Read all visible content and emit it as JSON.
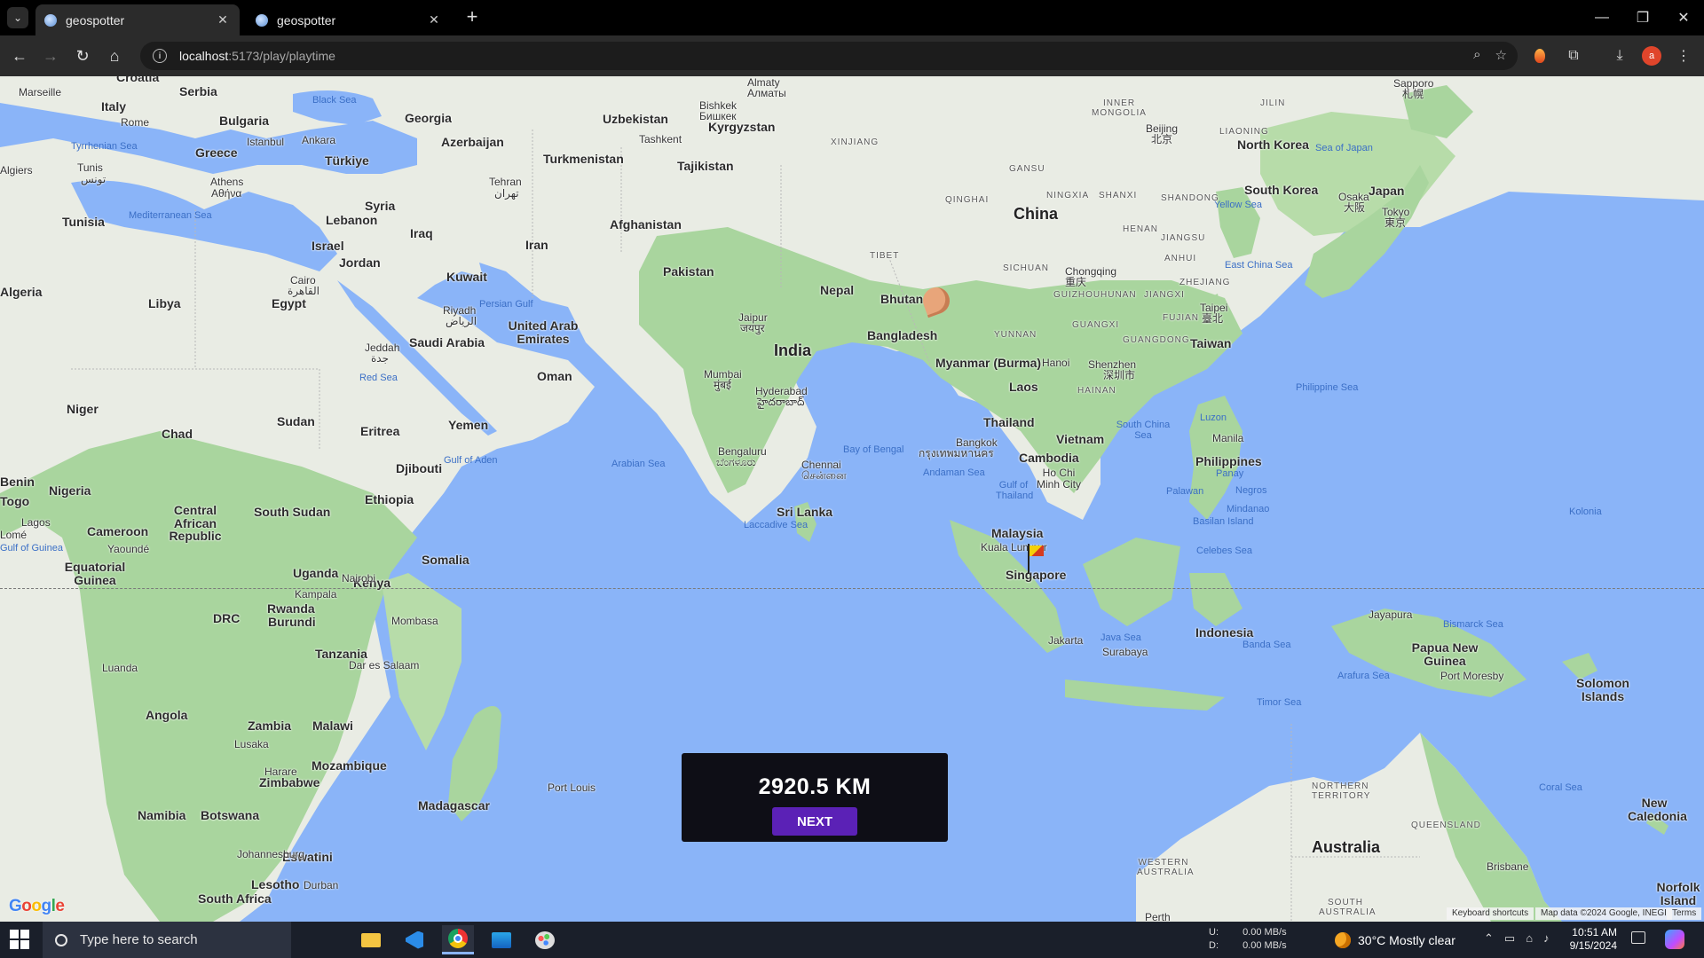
{
  "browser": {
    "tabs": [
      {
        "title": "geospotter",
        "active": true
      },
      {
        "title": "geospotter",
        "active": false
      }
    ],
    "url_host": "localhost",
    "url_path": ":5173/play/playtime",
    "profile_initial": "a"
  },
  "map": {
    "seas": [
      "Black Sea",
      "Tyrrhenian Sea",
      "Mediterranean Sea",
      "Persian Gulf",
      "Red Sea",
      "Gulf of Aden",
      "Arabian Sea",
      "Bay of Bengal",
      "Andaman Sea",
      "Gulf of Thailand",
      "Laccadive Sea",
      "South China Sea",
      "Philippine Sea",
      "East China Sea",
      "Sea of Japan",
      "Yellow Sea",
      "Celebes Sea",
      "Java Sea",
      "Banda Sea",
      "Arafura Sea",
      "Timor Sea",
      "Bismarck Sea",
      "Coral Sea",
      "Gulf of Guinea"
    ],
    "countries": [
      "Italy",
      "Bulgaria",
      "Greece",
      "Türkiye",
      "Georgia",
      "Azerbaijan",
      "Serbia",
      "Croatia",
      "Syria",
      "Lebanon",
      "Israel",
      "Jordan",
      "Iraq",
      "Iran",
      "Kuwait",
      "Saudi Arabia",
      "United Arab Emirates",
      "Oman",
      "Yemen",
      "Egypt",
      "Libya",
      "Tunisia",
      "Algeria",
      "Niger",
      "Chad",
      "Sudan",
      "Eritrea",
      "Djibouti",
      "Ethiopia",
      "Somalia",
      "Kenya",
      "Uganda",
      "South Sudan",
      "Central African Republic",
      "Cameroon",
      "Nigeria",
      "Equatorial Guinea",
      "DRC",
      "Rwanda",
      "Burundi",
      "Tanzania",
      "Angola",
      "Zambia",
      "Malawi",
      "Mozambique",
      "Zimbabwe",
      "Namibia",
      "Botswana",
      "Madagascar",
      "Eswatini",
      "Lesotho",
      "South Africa",
      "Turkmenistan",
      "Uzbekistan",
      "Kyrgyzstan",
      "Tajikistan",
      "Afghanistan",
      "Pakistan",
      "India",
      "Nepal",
      "Bhutan",
      "Bangladesh",
      "Sri Lanka",
      "Myanmar (Burma)",
      "Thailand",
      "Laos",
      "Vietnam",
      "Cambodia",
      "Malaysia",
      "Singapore",
      "Indonesia",
      "Philippines",
      "Taiwan",
      "South Korea",
      "Japan",
      "North Korea",
      "China",
      "Papua New Guinea",
      "Solomon Islands",
      "New Caledonia",
      "Australia",
      "Norfolk Island",
      "Benin",
      "Togo"
    ],
    "big_labels": {
      "china": "China",
      "india": "India",
      "australia": "Australia"
    },
    "cities": [
      "Marseille",
      "Rome",
      "Istanbul",
      "Ankara",
      "Athens",
      "Αθήνα",
      "Tunis",
      "تونس",
      "Algiers",
      "Tehran",
      "تهران",
      "Cairo",
      "القاهرة",
      "Riyadh",
      "الرياض",
      "Jeddah",
      "جدة",
      "Bishkek",
      "Бишкек",
      "Almaty",
      "Алматы",
      "Tashkent",
      "Jaipur",
      "जयपुर",
      "Mumbai",
      "मुंबई",
      "Hyderabad",
      "హైదరాబాద్",
      "Bengaluru",
      "ಬೆಂಗಳೂರು",
      "Chennai",
      "சென்னை",
      "Bangkok",
      "กรุงเทพมหานคร",
      "Hanoi",
      "Ho Chi Minh City",
      "Kuala Lumpur",
      "Jakarta",
      "Surabaya",
      "Manila",
      "Chongqing",
      "重庆",
      "Shenzhen",
      "深圳市",
      "Taipei",
      "臺北",
      "Beijing",
      "北京",
      "Osaka",
      "大阪",
      "Tokyo",
      "東京",
      "Sapporo",
      "札幌",
      "Lagos",
      "Lomé",
      "Yaoundé",
      "Kampala",
      "Nairobi",
      "Mombasa",
      "Dar es Salaam",
      "Lusaka",
      "Harare",
      "Johannesburg",
      "Durban",
      "Port Louis",
      "Port Moresby",
      "Brisbane",
      "Perth",
      "Jayapura",
      "Palawan",
      "Luzon",
      "Mindanao",
      "Panay",
      "Negros",
      "Basilan Island",
      "Kolonia",
      "Luanda",
      "Mombasa"
    ],
    "regions": [
      "INNER MONGOLIA",
      "JILIN",
      "LIAONING",
      "XINJIANG",
      "GANSU",
      "NINGXIA",
      "SHANXI",
      "SHANDONG",
      "HENAN",
      "JIANGSU",
      "ANHUI",
      "ZHEJIANG",
      "SICHUAN",
      "GUIZHOU",
      "HUNAN",
      "JIANGXI",
      "FUJIAN",
      "GUANGXI",
      "GUANGDONG",
      "YUNNAN",
      "HAINAN",
      "QINGHAI",
      "TIBET",
      "NORTHERN TERRITORY",
      "QUEENSLAND",
      "WESTERN AUSTRALIA",
      "SOUTH AUSTRALIA"
    ],
    "attribution": {
      "keyboard": "Keyboard shortcuts",
      "data": "Map data ©2024 Google, INEGI",
      "terms": "Terms"
    }
  },
  "result": {
    "distance": "2920.5 KM",
    "next_label": "NEXT"
  },
  "taskbar": {
    "search_placeholder": "Type here to search",
    "net_up_label": "U:",
    "net_down_label": "D:",
    "net_up": "0.00 MB/s",
    "net_down": "0.00 MB/s",
    "weather": "30°C  Mostly clear",
    "time": "10:51 AM",
    "date": "9/15/2024"
  }
}
